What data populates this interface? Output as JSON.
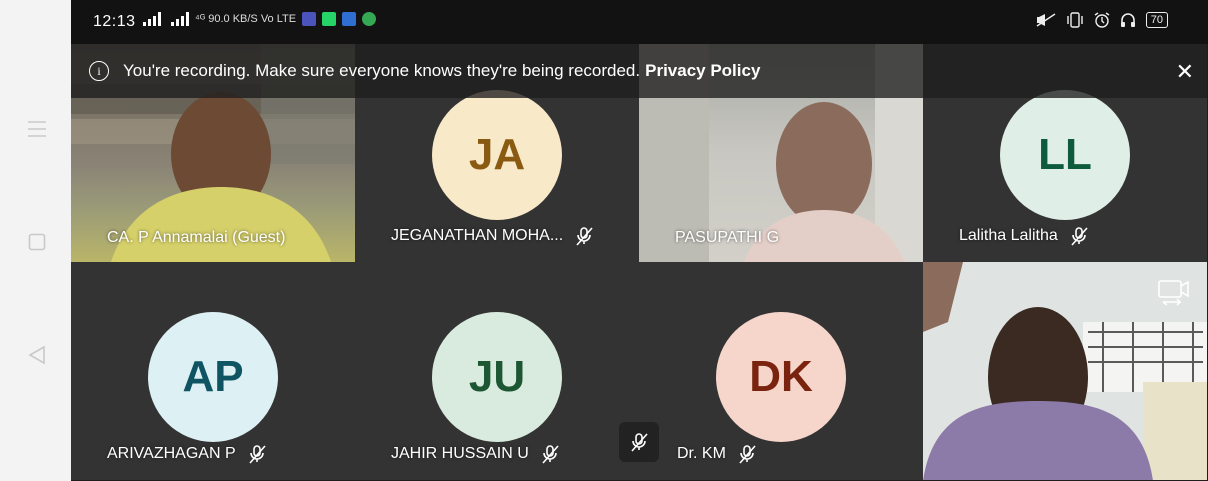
{
  "status_bar": {
    "time": "12:13",
    "left_icons": "⁴ᴳ 90.0 KB/S Vo LTE",
    "battery": "70"
  },
  "banner": {
    "message": "You're recording. Make sure everyone knows they're being recorded.",
    "link": "Privacy Policy"
  },
  "participants": [
    {
      "name": "CA. P Annamalai (Guest)",
      "type": "video"
    },
    {
      "name": "JEGANATHAN MOHA...",
      "initials": "JA",
      "type": "avatar",
      "avatar_color": "#f8e9c8",
      "text_color": "#8a5a12",
      "muted": true
    },
    {
      "name": "PASUPATHI G",
      "type": "video"
    },
    {
      "name": "Lalitha Lalitha",
      "initials": "LL",
      "type": "avatar",
      "avatar_color": "#dfeee6",
      "text_color": "#0e5a3c",
      "muted": true
    },
    {
      "name": "ARIVAZHAGAN P",
      "initials": "AP",
      "type": "avatar",
      "avatar_color": "#ddf0f3",
      "text_color": "#0f5462",
      "muted": true
    },
    {
      "name": "JAHIR HUSSAIN U",
      "initials": "JU",
      "type": "avatar",
      "avatar_color": "#d9eade",
      "text_color": "#1c5632",
      "muted": true
    },
    {
      "name": "Dr. KM",
      "initials": "DK",
      "type": "avatar",
      "avatar_color": "#f6d5cb",
      "text_color": "#7a2410",
      "muted": true
    }
  ],
  "icons": {
    "nav": [
      "menu-icon",
      "home-icon",
      "back-icon"
    ],
    "mute": "mic-off-icon",
    "close": "close-icon",
    "switch_camera": "switch-camera-icon"
  }
}
